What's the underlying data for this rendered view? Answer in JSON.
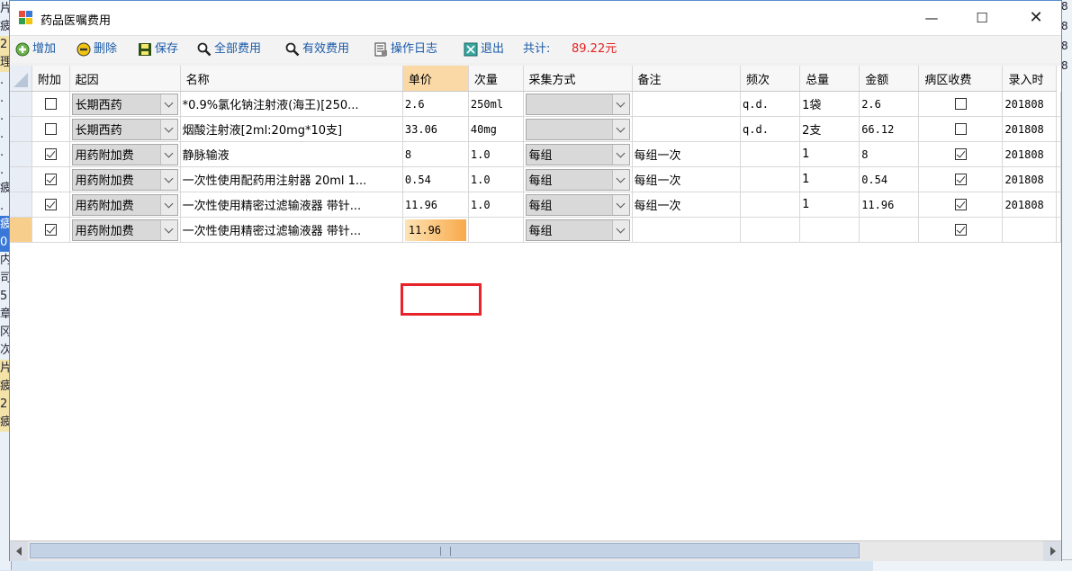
{
  "window": {
    "title": "药品医嘱费用",
    "minimize_glyph": "—",
    "maximize_glyph": "☐",
    "close_glyph": "✕"
  },
  "toolbar": {
    "add": "增加",
    "delete": "删除",
    "save": "保存",
    "all_fees": "全部费用",
    "valid_fees": "有效费用",
    "op_log": "操作日志",
    "exit": "退出",
    "total_label": "共计:",
    "total_value": "89.22元"
  },
  "grid": {
    "columns": [
      "附加",
      "起因",
      "名称",
      "单价",
      "次量",
      "采集方式",
      "备注",
      "频次",
      "总量",
      "金额",
      "病区收费",
      "录入时"
    ],
    "rows": [
      {
        "attached": false,
        "reason": "长期西药",
        "name": "*0.9%氯化钠注射液(海王)[250...",
        "price": "2.6",
        "dose": "250ml",
        "method": "",
        "note": "",
        "freq": "q.d.",
        "total": "1袋",
        "amount": "2.6",
        "ward": false,
        "entry": "201808"
      },
      {
        "attached": false,
        "reason": "长期西药",
        "name": "烟酸注射液[2ml:20mg*10支]",
        "price": "33.06",
        "dose": "40mg",
        "method": "",
        "note": "",
        "freq": "q.d.",
        "total": "2支",
        "amount": "66.12",
        "ward": false,
        "entry": "201808"
      },
      {
        "attached": true,
        "reason": "用药附加费",
        "name": "静脉输液",
        "price": "8",
        "dose": "1.0",
        "method": "每组",
        "note": "每组一次",
        "freq": "",
        "total": "1",
        "amount": "8",
        "ward": true,
        "entry": "201808"
      },
      {
        "attached": true,
        "reason": "用药附加费",
        "name": "一次性使用配药用注射器 20ml 1...",
        "price": "0.54",
        "dose": "1.0",
        "method": "每组",
        "note": "每组一次",
        "freq": "",
        "total": "1",
        "amount": "0.54",
        "ward": true,
        "entry": "201808"
      },
      {
        "attached": true,
        "reason": "用药附加费",
        "name": "一次性使用精密过滤输液器 带针...",
        "price": "11.96",
        "dose": "1.0",
        "method": "每组",
        "note": "每组一次",
        "freq": "",
        "total": "1",
        "amount": "11.96",
        "ward": true,
        "entry": "201808"
      },
      {
        "attached": true,
        "reason": "用药附加费",
        "name": "一次性使用精密过滤输液器 带针...",
        "price": "11.96",
        "dose": "",
        "method": "每组",
        "note": "",
        "freq": "",
        "total": "",
        "amount": "",
        "ward": true,
        "entry": ""
      }
    ]
  },
  "colors": {
    "accent": "#1a5aa8",
    "total": "#e52222",
    "highlight": "#e8232a",
    "selected_header": "#fbd9a6"
  }
}
